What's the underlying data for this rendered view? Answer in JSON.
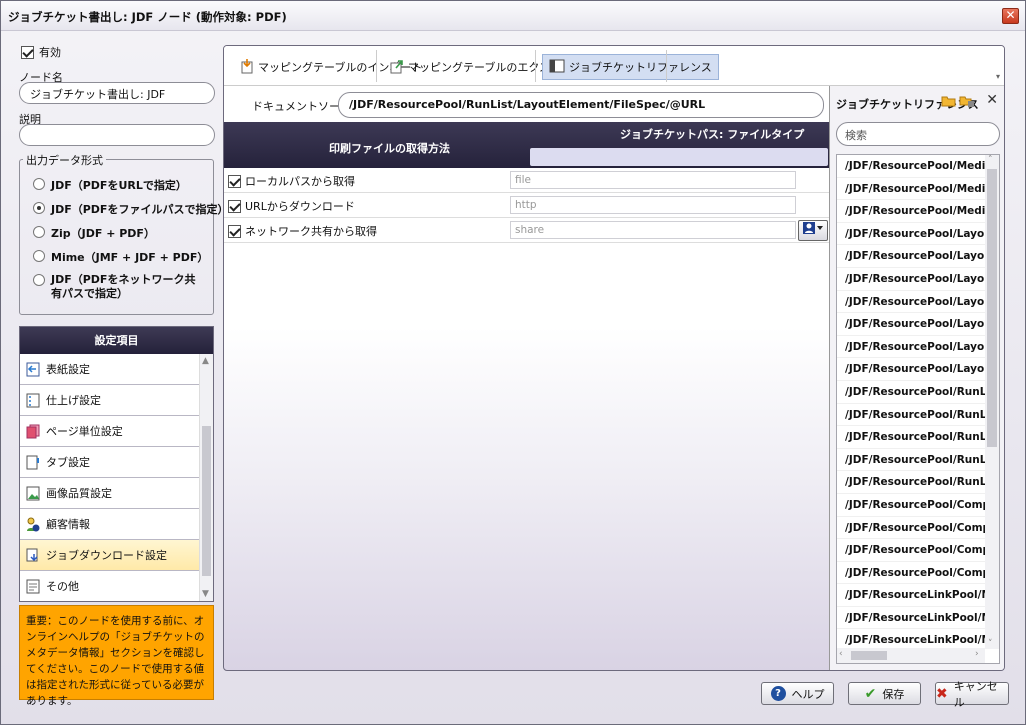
{
  "window": {
    "title": "ジョブチケット書出し: JDF ノード (動作対象: PDF)"
  },
  "left": {
    "enabled_label": "有効",
    "node_name_label": "ノード名",
    "node_name_value": "ジョブチケット書出し: JDF",
    "description_label": "説明",
    "description_value": "",
    "output_format": {
      "title": "出力データ形式",
      "options": [
        {
          "label": "JDF（PDFをURLで指定）",
          "selected": false
        },
        {
          "label": "JDF（PDFをファイルパスで指定）",
          "selected": true
        },
        {
          "label": "Zip（JDF + PDF）",
          "selected": false
        },
        {
          "label": "Mime（JMF + JDF + PDF）",
          "selected": false
        },
        {
          "label": "JDF（PDFをネットワーク共有パスで指定）",
          "selected": false
        }
      ]
    },
    "settings": {
      "header": "設定項目",
      "items": [
        {
          "label": "表紙設定",
          "icon": "cover-icon"
        },
        {
          "label": "仕上げ設定",
          "icon": "finishing-icon"
        },
        {
          "label": "ページ単位設定",
          "icon": "pages-icon"
        },
        {
          "label": "タブ設定",
          "icon": "tab-icon"
        },
        {
          "label": "画像品質設定",
          "icon": "image-icon"
        },
        {
          "label": "顧客情報",
          "icon": "customer-icon"
        },
        {
          "label": "ジョブダウンロード設定",
          "icon": "download-icon",
          "active": true
        },
        {
          "label": "その他",
          "icon": "other-icon"
        }
      ]
    },
    "notice": "重要：このノードを使用する前に、オンラインヘルプの「ジョブチケットのメタデータ情報」セクションを確認してください。このノードで使用する値は指定された形式に従っている必要があります。"
  },
  "toolbar": {
    "import_label": "マッピングテーブルのインポート",
    "export_label": "マッピングテーブルのエクスポート",
    "reference_label": "ジョブチケットリファレンス"
  },
  "document_source": {
    "label": "ドキュメントソース",
    "value": "/JDF/ResourcePool/RunList/LayoutElement/FileSpec/@URL"
  },
  "grid": {
    "col1": "印刷ファイルの取得方法",
    "col2": "ジョブチケットパス: ファイルタイプ",
    "rows": [
      {
        "label": "ローカルパスから取得",
        "value": "file",
        "checked": true
      },
      {
        "label": "URLからダウンロード",
        "value": "http",
        "checked": true
      },
      {
        "label": "ネットワーク共有から取得",
        "value": "share",
        "checked": true
      }
    ]
  },
  "reference": {
    "title": "ジョブチケットリファレンス",
    "search_placeholder": "検索",
    "items": [
      "/JDF/ResourcePool/Media/@Cl",
      "/JDF/ResourcePool/Media/@ID",
      "/JDF/ResourcePool/Media/@St",
      "/JDF/ResourcePool/LayoutPrep",
      "/JDF/ResourcePool/LayoutPrep",
      "/JDF/ResourcePool/LayoutPrep",
      "/JDF/ResourcePool/LayoutPrep",
      "/JDF/ResourcePool/LayoutPrep",
      "/JDF/ResourcePool/LayoutPrep",
      "/JDF/ResourcePool/LayoutPrep",
      "/JDF/ResourcePool/RunList/@C",
      "/JDF/ResourcePool/RunList/@I",
      "/JDF/ResourcePool/RunList/@N",
      "/JDF/ResourcePool/RunList/@S",
      "/JDF/ResourcePool/RunList/Lay",
      "/JDF/ResourcePool/Componen",
      "/JDF/ResourcePool/Componen",
      "/JDF/ResourcePool/Componen",
      "/JDF/ResourcePool/Componen",
      "/JDF/ResourceLinkPool/Medial",
      "/JDF/ResourceLinkPool/Medial",
      "/JDF/ResourceLinkPool/Medial"
    ]
  },
  "buttons": {
    "help": "ヘルプ",
    "save": "保存",
    "cancel": "キャンセル"
  },
  "colors": {
    "header_dark": "#2d2944",
    "notice": "#ffa400",
    "active_item": "#ffe9a8",
    "close": "#c8391e"
  }
}
